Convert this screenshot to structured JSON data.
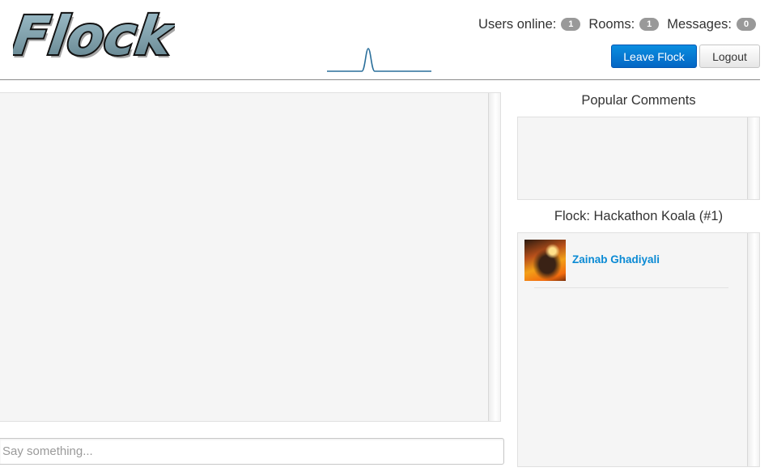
{
  "header": {
    "logo_text": "Flock",
    "stats": [
      {
        "label": "Users online:",
        "count": "1"
      },
      {
        "label": "Rooms:",
        "count": "1"
      },
      {
        "label": "Messages:",
        "count": "0"
      }
    ],
    "leave_button": "Leave Flock",
    "logout_button": "Logout",
    "accent_color": "#0a7fd6"
  },
  "sidebar": {
    "popular_title": "Popular Comments",
    "flock_title": "Flock: Hackathon Koala (#1)",
    "members": [
      {
        "name": "Zainab Ghadiyali",
        "avatar_icon": "user-avatar"
      }
    ]
  },
  "chat": {
    "input_placeholder": "Say something...",
    "input_value": ""
  }
}
